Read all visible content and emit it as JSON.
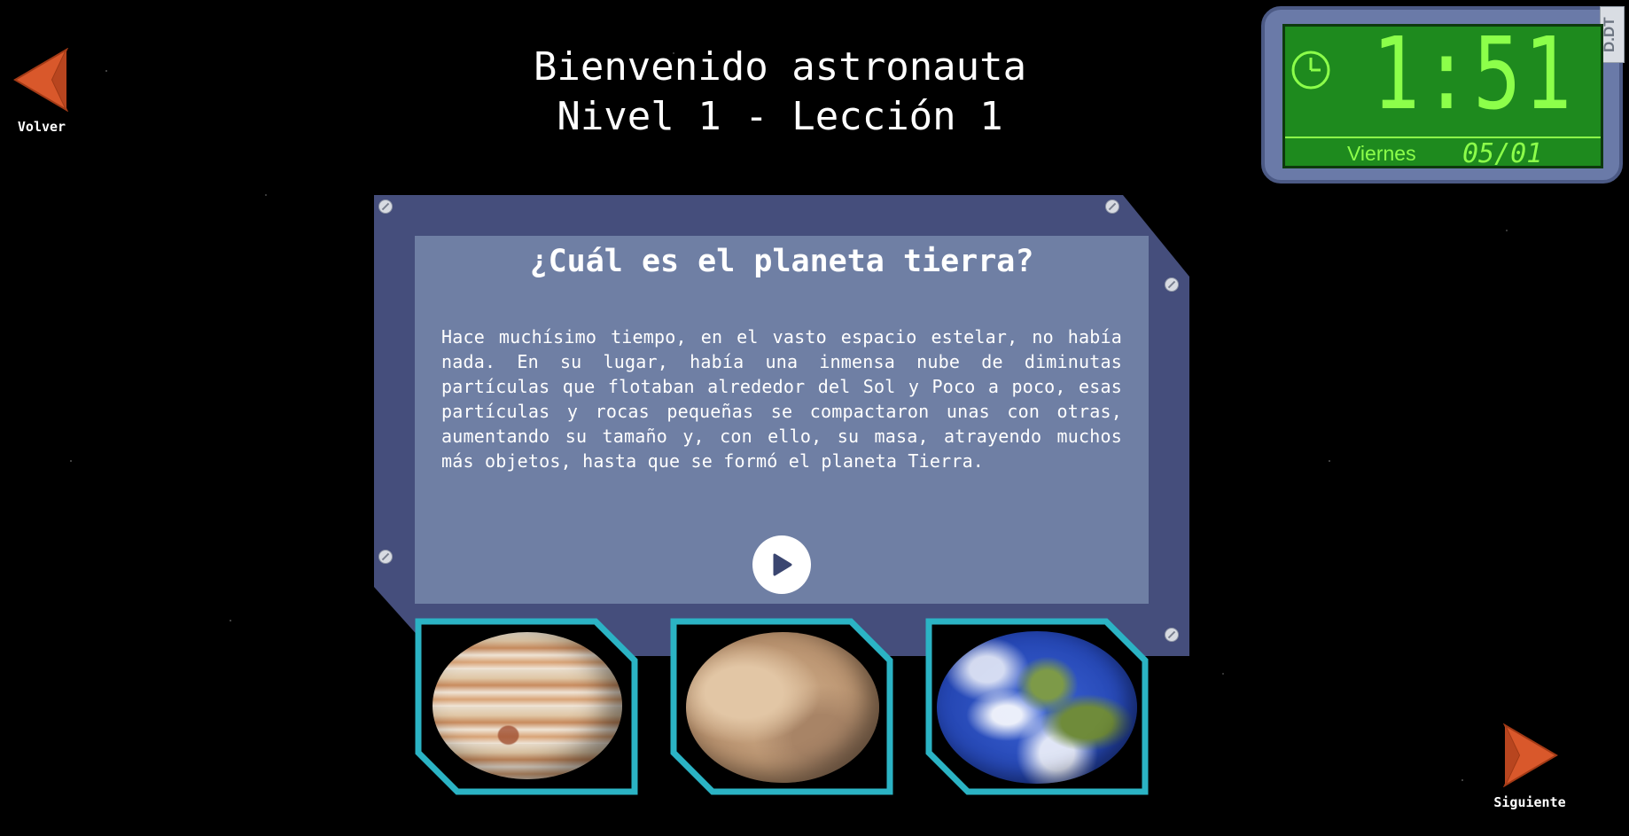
{
  "navigation": {
    "back_label": "Volver",
    "next_label": "Siguiente"
  },
  "header": {
    "line1": "Bienvenido astronauta",
    "line2": "Nivel 1 - Lección 1"
  },
  "clock": {
    "time": "1:51",
    "day": "Viernes",
    "date": "05/01",
    "badge": "D.DT"
  },
  "question": {
    "title": "¿Cuál es el planeta tierra?",
    "text": "Hace muchísimo tiempo, en el vasto espacio estelar, no había nada. En su lugar, había una inmensa nube de diminutas partículas que flotaban alrededor del Sol y Poco a poco, esas partículas y rocas pequeñas se compactaron unas con otras, aumentando su tamaño y, con ello, su masa, atrayendo muchos más objetos, hasta que se formó el planeta Tierra."
  },
  "options": [
    {
      "planet": "jupiter"
    },
    {
      "planet": "mars"
    },
    {
      "planet": "earth"
    }
  ],
  "colors": {
    "arrow": "#d9582b",
    "panel_frame": "#454e7c",
    "panel_inner": "#6f7fa4",
    "option_border": "#2bb3c4",
    "clock_green": "#1e8a1e",
    "clock_digits": "#8cff4a"
  }
}
